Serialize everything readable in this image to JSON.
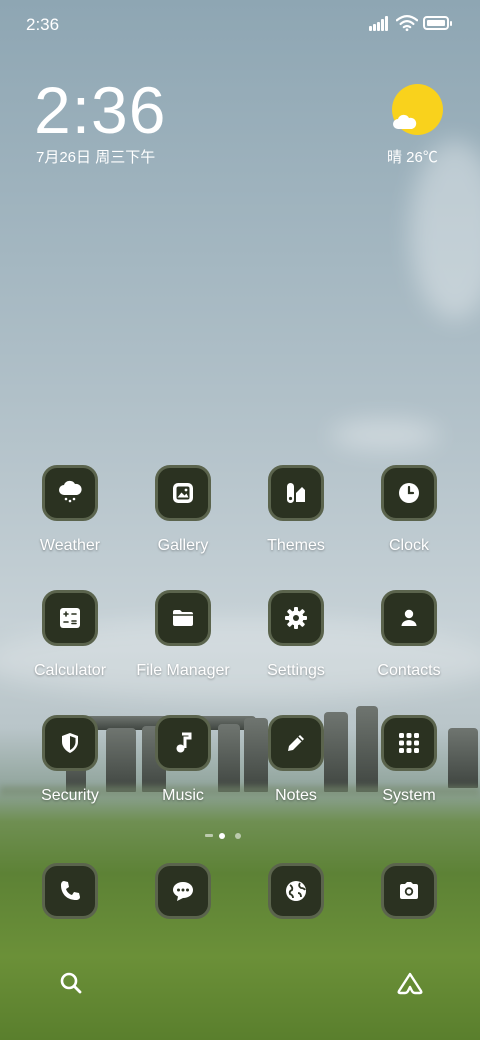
{
  "status_bar": {
    "time": "2:36"
  },
  "widget": {
    "clock": "2:36",
    "date": "7月26日 周三下午",
    "weather": "晴 26℃"
  },
  "apps": [
    {
      "label": "Weather",
      "icon": "weather-icon"
    },
    {
      "label": "Gallery",
      "icon": "gallery-icon"
    },
    {
      "label": "Themes",
      "icon": "themes-icon"
    },
    {
      "label": "Clock",
      "icon": "clock-icon"
    },
    {
      "label": "Calculator",
      "icon": "calculator-icon"
    },
    {
      "label": "File Manager",
      "icon": "folder-icon"
    },
    {
      "label": "Settings",
      "icon": "gear-icon"
    },
    {
      "label": "Contacts",
      "icon": "person-icon"
    },
    {
      "label": "Security",
      "icon": "shield-icon"
    },
    {
      "label": "Music",
      "icon": "music-note-icon"
    },
    {
      "label": "Notes",
      "icon": "pencil-icon"
    },
    {
      "label": "System",
      "icon": "folder-grid-icon"
    }
  ],
  "dock": [
    {
      "icon": "phone-icon"
    },
    {
      "icon": "message-icon"
    },
    {
      "icon": "globe-icon"
    },
    {
      "icon": "camera-icon"
    }
  ],
  "page_indicator": {
    "pages": 2,
    "current": 1
  },
  "bottom": {
    "left": "search-icon",
    "right": "assistant-icon"
  },
  "colors": {
    "icon_bg": "#2b3221",
    "icon_border": "#5b644d",
    "sun": "#f9d21c"
  }
}
